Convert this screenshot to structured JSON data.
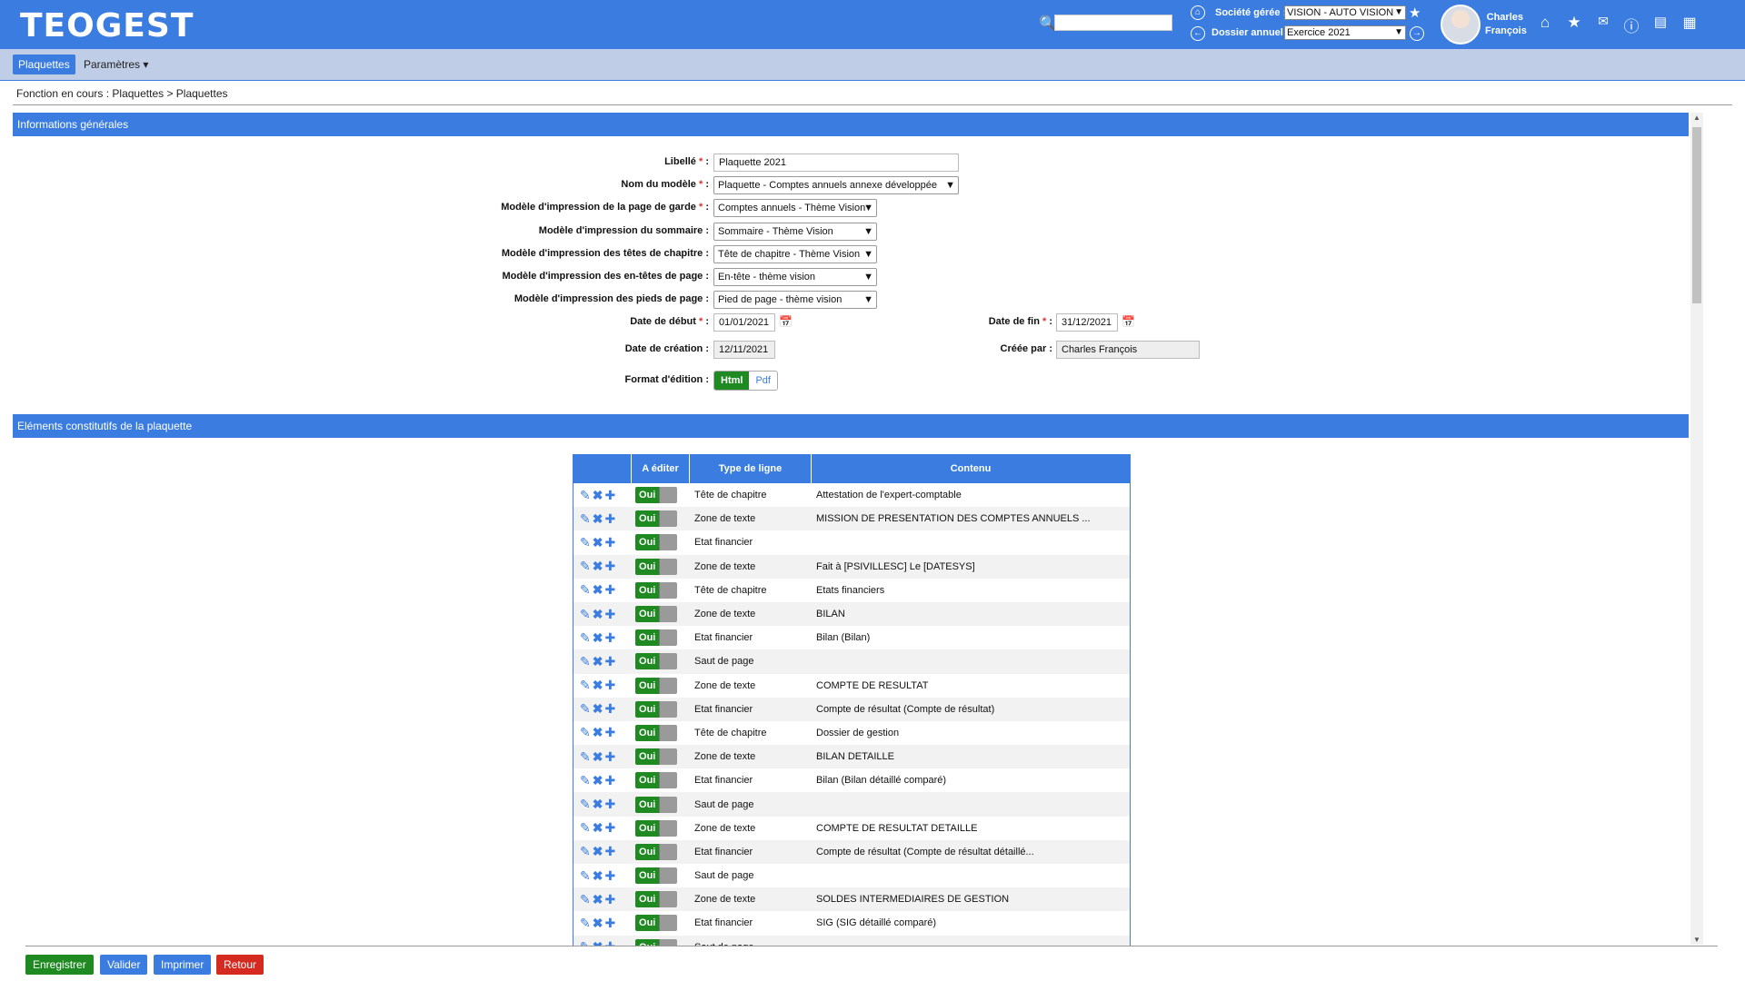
{
  "header": {
    "logo": "TEOGEST",
    "search": {
      "value": "",
      "placeholder": ""
    },
    "societe_label": "Société gérée :",
    "societe_value": "VISION - AUTO VISION",
    "dossier_label": "Dossier annuel :",
    "dossier_value": "Exercice 2021",
    "user_name_line1": "Charles",
    "user_name_line2": "François",
    "icons": [
      "search-icon",
      "home-icon",
      "star-icon",
      "prev-icon",
      "next-icon",
      "house-icon",
      "favorites-icon",
      "mail-icon",
      "help-icon",
      "document-icon",
      "apps-icon"
    ]
  },
  "menu": {
    "active": "Plaquettes",
    "params": "Paramètres ▾"
  },
  "breadcrumb": {
    "label": "Fonction en cours :",
    "path": "Plaquettes > Plaquettes"
  },
  "section1": {
    "title": "Informations générales",
    "fields": {
      "libelle_label": "Libellé",
      "libelle_value": "Plaquette 2021",
      "modele_label": "Nom du modèle",
      "modele_value": "Plaquette - Comptes annuels annexe développée",
      "garde_label": "Modèle d'impression de la page de garde",
      "garde_value": "Comptes annuels - Thème Vision",
      "sommaire_label": "Modèle d'impression du sommaire :",
      "sommaire_value": "Sommaire - Thème Vision",
      "chapitre_label": "Modèle d'impression des têtes de chapitre :",
      "chapitre_value": "Tête de chapitre - Thème Vision",
      "entete_label": "Modèle d'impression des en-têtes de page :",
      "entete_value": "En-tête - thème vision",
      "pied_label": "Modèle d'impression des pieds de page :",
      "pied_value": "Pied de page - thème vision",
      "date_debut_label": "Date de début",
      "date_debut_value": "01/01/2021",
      "date_fin_label": "Date de fin",
      "date_fin_value": "31/12/2021",
      "date_creation_label": "Date de création :",
      "date_creation_value": "12/11/2021",
      "creee_par_label": "Créée par :",
      "creee_par_value": "Charles François",
      "format_label": "Format d'édition :",
      "format_html": "Html",
      "format_pdf": "Pdf",
      "req_colon": ":",
      "req_star": "*"
    }
  },
  "section2": {
    "title": "Eléments constitutifs de la plaquette",
    "table": {
      "headers": [
        "",
        "A éditer",
        "Type de ligne",
        "Contenu"
      ],
      "toggle_label": "Oui",
      "rows": [
        {
          "type": "Tête de chapitre",
          "contenu": "Attestation de l'expert-comptable"
        },
        {
          "type": "Zone de texte",
          "contenu": "MISSION DE PRESENTATION DES COMPTES ANNUELS ..."
        },
        {
          "type": "Etat financier",
          "contenu": ""
        },
        {
          "type": "Zone de texte",
          "contenu": "Fait à [PSIVILLESC] Le [DATESYS]"
        },
        {
          "type": "Tête de chapitre",
          "contenu": "Etats financiers"
        },
        {
          "type": "Zone de texte",
          "contenu": "BILAN"
        },
        {
          "type": "Etat financier",
          "contenu": "Bilan (Bilan)"
        },
        {
          "type": "Saut de page",
          "contenu": ""
        },
        {
          "type": "Zone de texte",
          "contenu": "COMPTE DE RESULTAT"
        },
        {
          "type": "Etat financier",
          "contenu": "Compte de résultat (Compte de résultat)"
        },
        {
          "type": "Tête de chapitre",
          "contenu": "Dossier de gestion"
        },
        {
          "type": "Zone de texte",
          "contenu": "BILAN DETAILLE"
        },
        {
          "type": "Etat financier",
          "contenu": "Bilan (Bilan détaillé comparé)"
        },
        {
          "type": "Saut de page",
          "contenu": ""
        },
        {
          "type": "Zone de texte",
          "contenu": "COMPTE DE RESULTAT DETAILLE"
        },
        {
          "type": "Etat financier",
          "contenu": "Compte de résultat (Compte de résultat détaillé..."
        },
        {
          "type": "Saut de page",
          "contenu": ""
        },
        {
          "type": "Zone de texte",
          "contenu": "SOLDES INTERMEDIAIRES DE GESTION"
        },
        {
          "type": "Etat financier",
          "contenu": "SIG (SIG détaillé comparé)"
        },
        {
          "type": "Saut de page",
          "contenu": ""
        }
      ]
    }
  },
  "footer": {
    "enregistrer": "Enregistrer",
    "valider": "Valider",
    "imprimer": "Imprimer",
    "retour": "Retour"
  },
  "colors": {
    "primary": "#3a7ce0",
    "green": "#1f8a22",
    "red": "#d42a20",
    "menubar": "#bfcde6"
  }
}
